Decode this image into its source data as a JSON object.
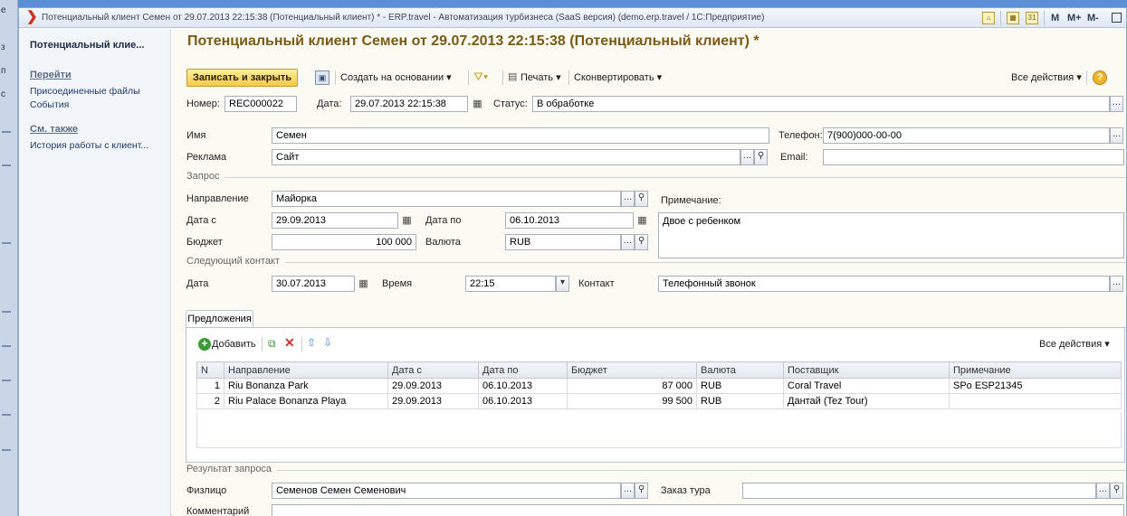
{
  "window": {
    "title": "Потенциальный клиент Семен от 29.07.2013 22:15:38 (Потенциальный клиент) * - ERP.travel - Автоматизация турбизнеса (SaaS версия) (demo.erp.travel / 1С:Предприятие)",
    "m_labels": [
      "M",
      "M+",
      "M-"
    ]
  },
  "left_strip": {
    "chars": [
      "е",
      "з",
      "п",
      "с"
    ]
  },
  "left_panel": {
    "current": "Потенциальный клие...",
    "goto_header": "Перейти",
    "goto_items": [
      "Присоединенные файлы",
      "События"
    ],
    "see_also_header": "См. также",
    "see_also_items": [
      "История работы с клиент..."
    ]
  },
  "heading": "Потенциальный клиент Семен от 29.07.2013 22:15:38 (Потенциальный клиент) *",
  "toolbar": {
    "save_close": "Записать и закрыть",
    "create_based": "Создать на основании ▾",
    "print": "Печать ▾",
    "convert": "Сконвертировать ▾",
    "all_actions": "Все действия ▾"
  },
  "header_fields": {
    "number_label": "Номер:",
    "number_value": "REC000022",
    "date_label": "Дата:",
    "date_value": "29.07.2013 22:15:38",
    "status_label": "Статус:",
    "status_value": "В обработке"
  },
  "client": {
    "name_label": "Имя",
    "name_value": "Семен",
    "phone_label": "Телефон:",
    "phone_value": "7(900)000-00-00",
    "ad_label": "Реклама",
    "ad_value": "Сайт",
    "email_label": "Email:",
    "email_value": ""
  },
  "request": {
    "group_label": "Запрос",
    "direction_label": "Направление",
    "direction_value": "Майорка",
    "note_label": "Примечание:",
    "note_value": "Двое с ребенком",
    "date_from_label": "Дата с",
    "date_from_value": "29.09.2013",
    "date_to_label": "Дата по",
    "date_to_value": "06.10.2013",
    "budget_label": "Бюджет",
    "budget_value": "100 000",
    "currency_label": "Валюта",
    "currency_value": "RUB"
  },
  "next_contact": {
    "group_label": "Следующий контакт",
    "date_label": "Дата",
    "date_value": "30.07.2013",
    "time_label": "Время",
    "time_value": "22:15",
    "contact_label": "Контакт",
    "contact_value": "Телефонный звонок"
  },
  "offers": {
    "tab_label": "Предложения",
    "add_label": "Добавить",
    "all_actions": "Все действия ▾",
    "columns": [
      "N",
      "Направление",
      "Дата с",
      "Дата по",
      "Бюджет",
      "Валюта",
      "Поставщик",
      "Примечание"
    ],
    "rows": [
      [
        "1",
        "Riu Bonanza Park",
        "29.09.2013",
        "06.10.2013",
        "87 000",
        "RUB",
        "Coral Travel",
        "SPo ESP21345"
      ],
      [
        "2",
        "Riu Palace Bonanza Playa",
        "29.09.2013",
        "06.10.2013",
        "99 500",
        "RUB",
        "Дантай (Tez Tour)",
        ""
      ]
    ]
  },
  "result": {
    "group_label": "Результат запроса",
    "person_label": "Физлицо",
    "person_value": "Семенов Семен Семенович",
    "tour_order_label": "Заказ тура",
    "tour_order_value": "",
    "comment_label": "Комментарий"
  }
}
